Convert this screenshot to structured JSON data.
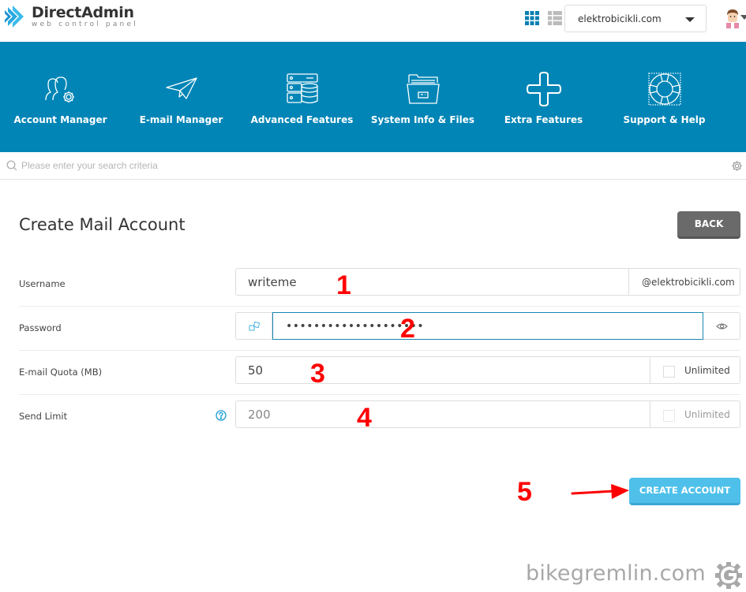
{
  "header": {
    "logo_title": "DirectAdmin",
    "logo_subtitle": "web control panel",
    "domain_selected": "elektrobicikli.com",
    "icons": [
      "grid-view-icon",
      "list-view-icon",
      "user-avatar-icon"
    ]
  },
  "nav": {
    "items": [
      {
        "label": "Account Manager",
        "icon": "users-gear-icon"
      },
      {
        "label": "E-mail Manager",
        "icon": "paper-plane-icon"
      },
      {
        "label": "Advanced Features",
        "icon": "server-database-icon"
      },
      {
        "label": "System Info & Files",
        "icon": "folder-files-icon"
      },
      {
        "label": "Extra Features",
        "icon": "plus-icon"
      },
      {
        "label": "Support & Help",
        "icon": "lifebuoy-icon"
      }
    ],
    "background": "#0185b6"
  },
  "search": {
    "placeholder": "Please enter your search criteria",
    "value": ""
  },
  "page": {
    "title": "Create Mail Account",
    "back_label": "BACK"
  },
  "form": {
    "username": {
      "label": "Username",
      "value": "writeme",
      "suffix": "@elektrobicikli.com"
    },
    "password": {
      "label": "Password",
      "value": "••••••••••••••••••••"
    },
    "quota": {
      "label": "E-mail Quota (MB)",
      "value": "50",
      "unlimited_label": "Unlimited",
      "unlimited_checked": false
    },
    "send_limit": {
      "label": "Send Limit",
      "value": "200",
      "unlimited_label": "Unlimited",
      "unlimited_checked": false,
      "unlimited_disabled": true
    },
    "submit_label": "CREATE ACCOUNT"
  },
  "annotations": [
    "1",
    "2",
    "3",
    "4",
    "5"
  ],
  "watermark": "bikegremlin.com",
  "colors": {
    "accent": "#0185b6",
    "create_button": "#4ec0ea",
    "back_button": "#6a6a6a",
    "annotation": "#ff0000"
  }
}
